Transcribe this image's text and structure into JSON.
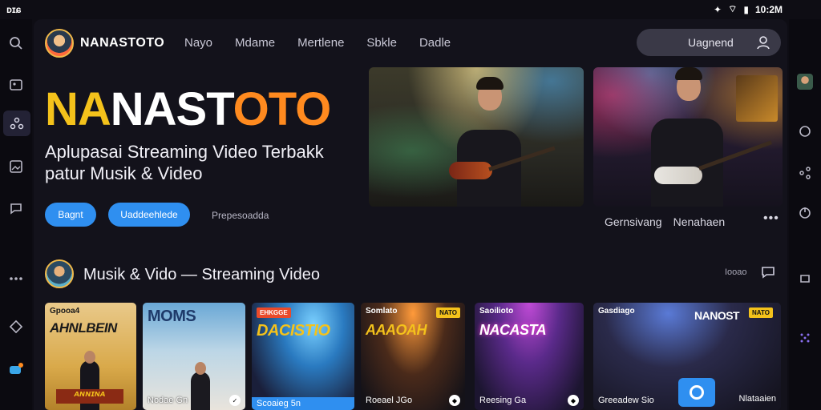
{
  "status": {
    "left": "ᴅɪɕ",
    "time": "10:2M"
  },
  "header": {
    "brand": "NANASTOTO",
    "nav": [
      "Nayo",
      "Mdame",
      "Mertlene",
      "Sbkle",
      "Dadle"
    ],
    "search_label": "Uagnend"
  },
  "hero": {
    "title_part1": "NA",
    "title_part2": "NAST",
    "title_part3": "OTO",
    "subtitle": "Aplupasai Streaming Video Terbakk patur Musik & Video",
    "btn_primary": "Bagnt",
    "btn_secondary": "Uaddeehlede",
    "btn_ghost": "Prepesoadda",
    "caption_1": "Gernsivang",
    "caption_2": "Nenahaen",
    "more": "•••"
  },
  "section": {
    "title": "Musik & Vido — Streaming Video",
    "right_label": "Iooao"
  },
  "tiles": [
    {
      "top": "Gpooa4",
      "big": "AHNLBEIN",
      "bottom": "",
      "tag": ""
    },
    {
      "top": "",
      "big": "MOMS",
      "bottom": "Nodae Gn",
      "tag": ""
    },
    {
      "top": "",
      "big": "DACISTIO",
      "bottom": "Scoaieg 5n",
      "tag": "EHKGGE"
    },
    {
      "top": "Somlato",
      "big": "AAAOAH",
      "bottom": "Roeael JGo",
      "tag": "NATO"
    },
    {
      "top": "Saoilioto",
      "big": "NACASTA",
      "bottom": "Reesing Ga",
      "tag": ""
    },
    {
      "top": "Gasdiago",
      "big": "NANOST",
      "bottom": "Greeadew Sio",
      "tag": "NATO"
    }
  ],
  "tile_extra": {
    "label_right": "Nlataaien"
  },
  "colors": {
    "accent_blue": "#2f8ff0",
    "brand_yellow": "#f4c21b",
    "brand_orange": "#ff8a1f",
    "background": "#13121b"
  }
}
